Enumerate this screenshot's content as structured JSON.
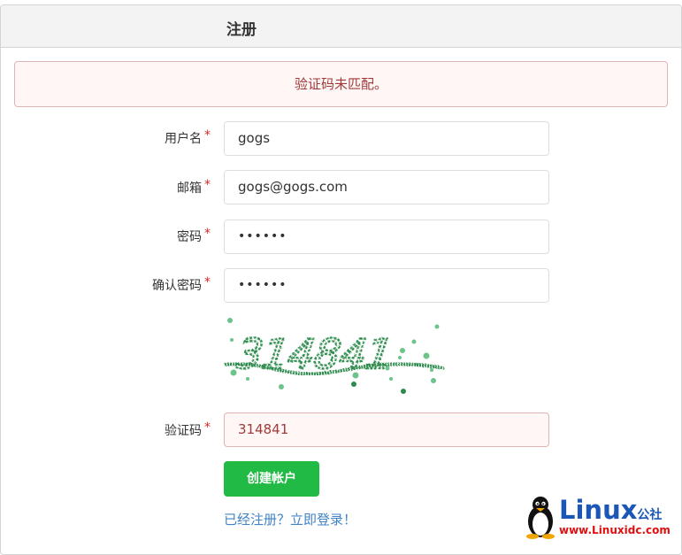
{
  "header": {
    "title": "注册"
  },
  "alert": {
    "message": "验证码未匹配。"
  },
  "form": {
    "required_mark": "*",
    "username": {
      "label": "用户名",
      "value": "gogs"
    },
    "email": {
      "label": "邮箱",
      "value": "gogs@gogs.com"
    },
    "password": {
      "label": "密码",
      "value": "••••••"
    },
    "confirm_password": {
      "label": "确认密码",
      "value": "••••••"
    },
    "captcha_image_text": "314841",
    "captcha": {
      "label": "验证码",
      "value": "314841"
    },
    "submit_label": "创建帐户",
    "login_link": "已经注册？立即登录！"
  },
  "watermark": {
    "brand": "Linux",
    "suffix": "公社",
    "url": "www.Linuxidc.com"
  },
  "colors": {
    "primary_button": "#21ba45",
    "error_bg": "#fff6f6",
    "error_text": "#9f3a38",
    "link": "#4183c4",
    "required": "#db2828"
  }
}
